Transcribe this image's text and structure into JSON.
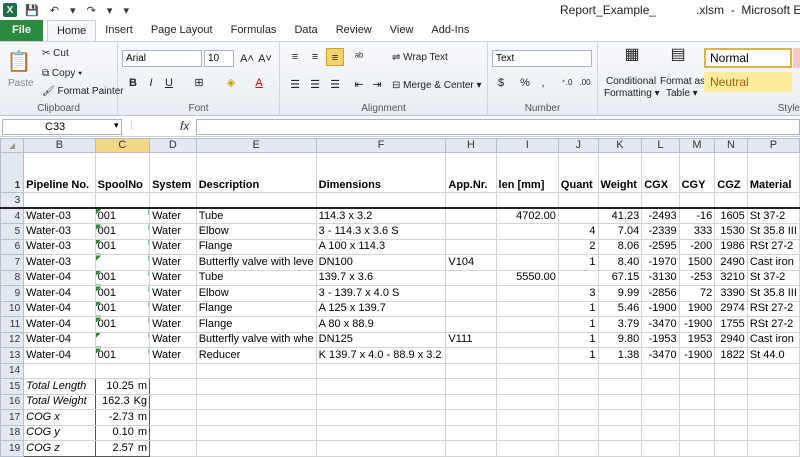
{
  "window": {
    "title": "Report_Example_            .xlsm  -  Microsoft Excel",
    "app_icon": "X"
  },
  "tabs": [
    "File",
    "Home",
    "Insert",
    "Page Layout",
    "Formulas",
    "Data",
    "Review",
    "View",
    "Add-Ins"
  ],
  "ribbon": {
    "clipboard": {
      "label": "Clipboard",
      "paste": "Paste",
      "cut": "Cut",
      "copy": "Copy",
      "format_painter": "Format Painter"
    },
    "font": {
      "label": "Font",
      "name": "Arial",
      "size": "10"
    },
    "alignment": {
      "label": "Alignment",
      "wrap": "Wrap Text",
      "merge": "Merge & Center"
    },
    "number": {
      "label": "Number",
      "format": "Text",
      "currency": "$",
      "percent": "%",
      "comma": ","
    },
    "styles": {
      "cond": "Conditional",
      "cond2": "Formatting",
      "fmt_table": "Format as",
      "fmt_table2": "Table",
      "normal": "Normal",
      "neutral": "Neutral",
      "label": "Style"
    }
  },
  "formula_bar": {
    "cell": "C33",
    "fx": "fx",
    "value": ""
  },
  "columns": [
    "B",
    "C",
    "D",
    "E",
    "F",
    "H",
    "I",
    "J",
    "K",
    "L",
    "M",
    "N",
    "P"
  ],
  "selected_column": "C",
  "headers": [
    "Pipeline No.",
    "SpoolNo",
    "System",
    "Description",
    "Dimensions",
    "App.Nr.",
    "len [mm]",
    "Quant",
    "Weight",
    "CGX",
    "CGY",
    "CGZ",
    "Material"
  ],
  "rows": [
    {
      "n": "4",
      "c": [
        "Water-03",
        "001",
        "Water",
        "Tube",
        "114.3 x 3.2",
        "",
        "4702.00",
        "",
        "41.23",
        "-2493",
        "-16",
        "1605",
        "St 37-2"
      ]
    },
    {
      "n": "5",
      "c": [
        "Water-03",
        "001",
        "Water",
        "Elbow",
        "3 - 114.3 x 3.6 S",
        "",
        "",
        "4",
        "7.04",
        "-2339",
        "333",
        "1530",
        "St 35.8 III"
      ]
    },
    {
      "n": "6",
      "c": [
        "Water-03",
        "001",
        "Water",
        "Flange",
        "A 100 x 114.3",
        "",
        "",
        "2",
        "8.06",
        "-2595",
        "-200",
        "1986",
        "RSt 27-2"
      ]
    },
    {
      "n": "7",
      "c": [
        "Water-03",
        "",
        "Water",
        "Butterfly valve with leve",
        "DN100",
        "V104",
        "",
        "1",
        "8.40",
        "-1970",
        "1500",
        "2490",
        "Cast iron"
      ]
    },
    {
      "n": "8",
      "c": [
        "Water-04",
        "001",
        "Water",
        "Tube",
        "139.7 x 3.6",
        "",
        "5550.00",
        "",
        "67.15",
        "-3130",
        "-253",
        "3210",
        "St 37-2"
      ]
    },
    {
      "n": "9",
      "c": [
        "Water-04",
        "001",
        "Water",
        "Elbow",
        "3 - 139.7 x 4.0 S",
        "",
        "",
        "3",
        "9.99",
        "-2856",
        "72",
        "3390",
        "St 35.8 III"
      ]
    },
    {
      "n": "10",
      "c": [
        "Water-04",
        "001",
        "Water",
        "Flange",
        "A 125 x 139.7",
        "",
        "",
        "1",
        "5.46",
        "-1900",
        "1900",
        "2974",
        "RSt 27-2"
      ]
    },
    {
      "n": "11",
      "c": [
        "Water-04",
        "001",
        "Water",
        "Flange",
        "A 80 x 88.9",
        "",
        "",
        "1",
        "3.79",
        "-3470",
        "-1900",
        "1755",
        "RSt 27-2"
      ]
    },
    {
      "n": "12",
      "c": [
        "Water-04",
        "",
        "Water",
        "Butterfly valve with whe",
        "DN125",
        "V111",
        "",
        "1",
        "9.80",
        "-1953",
        "1953",
        "2940",
        "Cast iron"
      ]
    },
    {
      "n": "13",
      "c": [
        "Water-04",
        "001",
        "Water",
        "Reducer",
        "K 139.7 x 4.0 - 88.9 x 3.2",
        "",
        "",
        "1",
        "1.38",
        "-3470",
        "-1900",
        "1822",
        "St 44.0"
      ]
    }
  ],
  "summary": [
    {
      "n": "15",
      "label": "Total Length",
      "value": "10.25",
      "unit": "m"
    },
    {
      "n": "16",
      "label": "Total Weight",
      "value": "162.3",
      "unit": "Kg"
    },
    {
      "n": "17",
      "label": "COG x",
      "value": "-2.73",
      "unit": "m"
    },
    {
      "n": "18",
      "label": "COG y",
      "value": "0.10",
      "unit": "m"
    },
    {
      "n": "19",
      "label": "COG z",
      "value": "2.57",
      "unit": "m"
    }
  ],
  "row_numbers": {
    "header": "1",
    "blank3": "3",
    "blank14": "14"
  }
}
